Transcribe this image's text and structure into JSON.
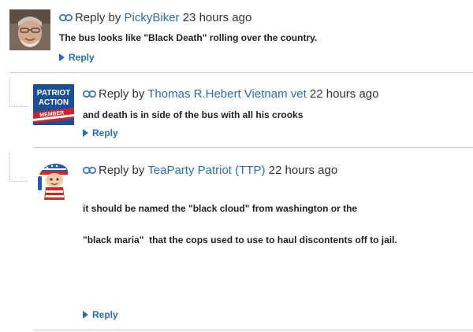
{
  "comments": [
    {
      "reply_prefix": "Reply by",
      "author": "PickyBiker",
      "time": "23 hours ago",
      "lines": [
        "The bus looks like \"Black Death\" rolling over the country."
      ],
      "reply_label": "Reply"
    },
    {
      "reply_prefix": "Reply by",
      "author": "Thomas R.Hebert Vietnam vet",
      "time": "22 hours ago",
      "lines": [
        "and death is in side of the bus with all his crooks"
      ],
      "reply_label": "Reply",
      "badge": {
        "line1": "PATRIOT",
        "line2": "ACTION",
        "line3": "MEMBER"
      }
    },
    {
      "reply_prefix": "Reply by",
      "author": "TeaParty Patriot (TTP)",
      "time": "22 hours ago",
      "lines": [
        "it should be named the \"black cloud\" from washington or the",
        "\"black maria\"  that the cops used to use to haul discontents off to jail."
      ],
      "reply_label": "Reply"
    }
  ],
  "colors": {
    "link": "#2a6db0",
    "text": "#222222",
    "divider": "#c8c8c8"
  }
}
